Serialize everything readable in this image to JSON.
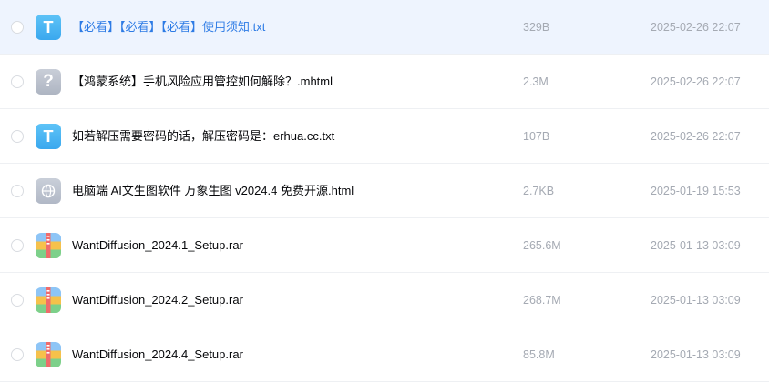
{
  "files": [
    {
      "name": "【必看】【必看】【必看】使用须知.txt",
      "size": "329B",
      "date": "2025-02-26 22:07",
      "icon": "txt-file-icon",
      "icon_glyph": "T"
    },
    {
      "name": "【鸿蒙系统】手机风险应用管控如何解除？.mhtml",
      "size": "2.3M",
      "date": "2025-02-26 22:07",
      "icon": "unknown-file-icon",
      "icon_glyph": "?"
    },
    {
      "name": "如若解压需要密码的话，解压密码是：erhua.cc.txt",
      "size": "107B",
      "date": "2025-02-26 22:07",
      "icon": "txt-file-icon",
      "icon_glyph": "T"
    },
    {
      "name": "电脑端 AI文生图软件 万象生图 v2024.4 免费开源.html",
      "size": "2.7KB",
      "date": "2025-01-19 15:53",
      "icon": "html-file-icon"
    },
    {
      "name": "WantDiffusion_2024.1_Setup.rar",
      "size": "265.6M",
      "date": "2025-01-13 03:09",
      "icon": "archive-file-icon"
    },
    {
      "name": "WantDiffusion_2024.2_Setup.rar",
      "size": "268.7M",
      "date": "2025-01-13 03:09",
      "icon": "archive-file-icon"
    },
    {
      "name": "WantDiffusion_2024.4_Setup.rar",
      "size": "85.8M",
      "date": "2025-01-13 03:09",
      "icon": "archive-file-icon"
    }
  ],
  "colors": {
    "highlight_row": "#eef4fe",
    "link_text": "#2d7be5",
    "meta_text": "#a5aab3",
    "txt_icon": "#3aa8ee"
  }
}
